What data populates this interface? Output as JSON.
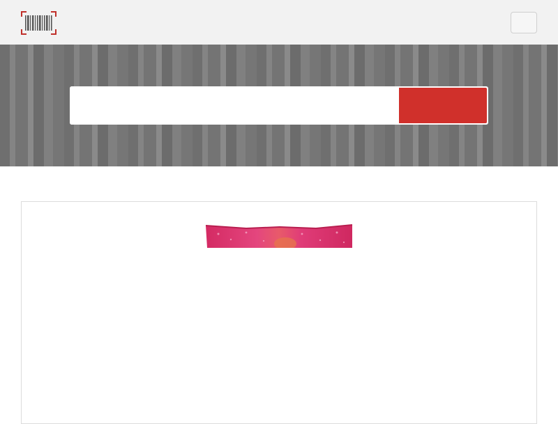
{
  "header": {
    "logo_icon": "barcode-scanner-icon",
    "menu_icon": "menu-icon"
  },
  "search": {
    "placeholder": "",
    "value": "",
    "button_label": ""
  },
  "colors": {
    "accent": "#d0302b",
    "topbar_bg": "#f2f2f2",
    "hero_bg": "#7a7a7a",
    "product_wrapper": "#e0306e"
  },
  "product": {
    "image_icon": "product-package-image"
  }
}
